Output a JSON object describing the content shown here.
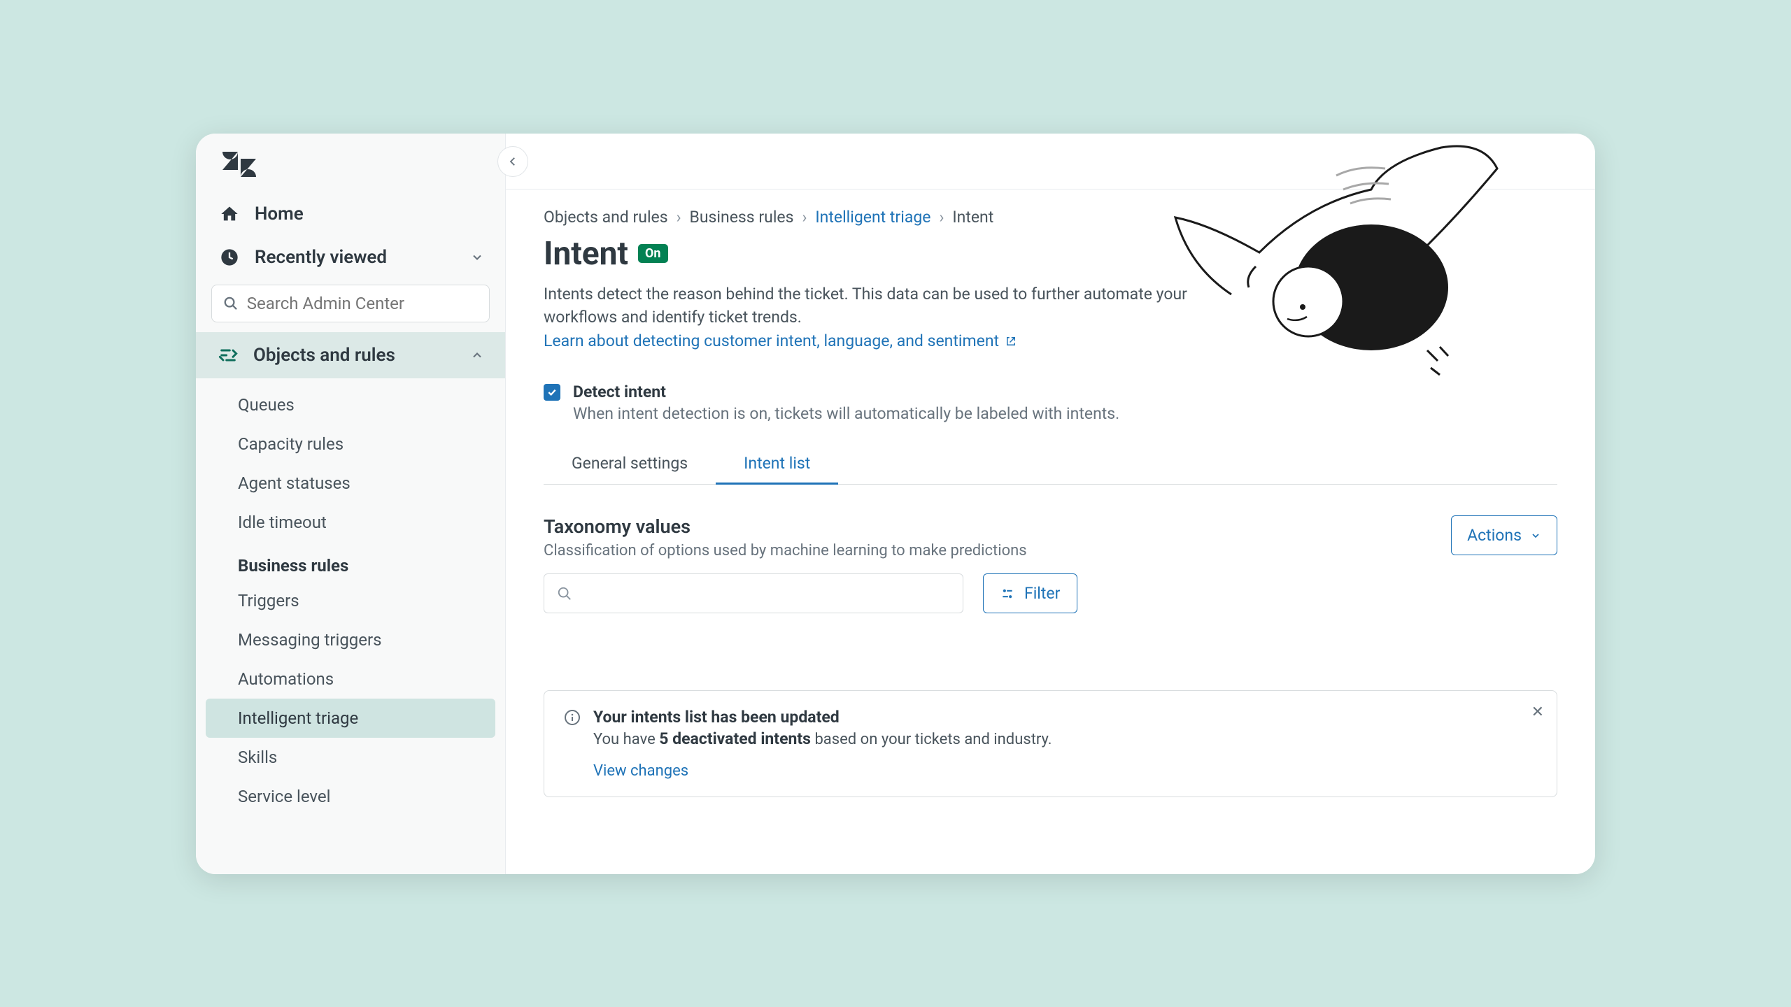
{
  "sidebar": {
    "home": "Home",
    "recent": "Recently viewed",
    "search_placeholder": "Search Admin Center",
    "section": "Objects and rules",
    "items1": [
      "Queues",
      "Capacity rules",
      "Agent statuses",
      "Idle timeout"
    ],
    "business_rules_head": "Business rules",
    "items2": [
      "Triggers",
      "Messaging triggers",
      "Automations",
      "Intelligent triage",
      "Skills",
      "Service level"
    ]
  },
  "breadcrumb": {
    "a": "Objects and rules",
    "b": "Business rules",
    "c": "Intelligent triage",
    "d": "Intent"
  },
  "page": {
    "title": "Intent",
    "badge": "On",
    "desc": "Intents detect the reason behind the ticket. This data can be used to further automate your workflows and identify ticket trends.",
    "learn": "Learn about detecting customer intent, language, and sentiment",
    "detect_label": "Detect intent",
    "detect_desc": "When intent detection is on, tickets will automatically be labeled with intents.",
    "tab1": "General settings",
    "tab2": "Intent list",
    "tax_title": "Taxonomy values",
    "tax_sub": "Classification of options used by machine learning to make predictions",
    "actions": "Actions",
    "filter": "Filter",
    "alert_title": "Your intents list has been updated",
    "alert_body_pre": "You have ",
    "alert_body_bold": "5 deactivated intents",
    "alert_body_post": " based on your tickets and industry.",
    "alert_view": "View changes"
  }
}
